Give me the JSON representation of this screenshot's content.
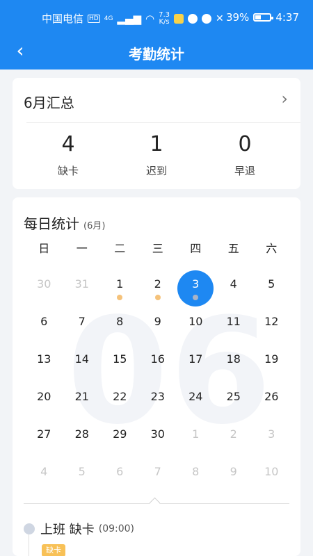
{
  "status_bar": {
    "carrier": "中国电信",
    "hd": "HD",
    "network": "4G",
    "speed_top": "7.3",
    "speed_bottom": "K/s",
    "battery": "39%",
    "time": "4:37"
  },
  "header": {
    "title": "考勤统计"
  },
  "summary": {
    "title": "6月汇总",
    "stats": [
      {
        "value": "4",
        "label": "缺卡"
      },
      {
        "value": "1",
        "label": "迟到"
      },
      {
        "value": "0",
        "label": "早退"
      }
    ]
  },
  "daily": {
    "title": "每日统计",
    "month_tag": "(6月)",
    "watermark": "06",
    "weekdays": [
      "日",
      "一",
      "二",
      "三",
      "四",
      "五",
      "六"
    ],
    "weeks": [
      [
        "30",
        "31",
        "1",
        "2",
        "3",
        "4",
        "5"
      ],
      [
        "6",
        "7",
        "8",
        "9",
        "10",
        "11",
        "12"
      ],
      [
        "13",
        "14",
        "15",
        "16",
        "17",
        "18",
        "19"
      ],
      [
        "20",
        "21",
        "22",
        "23",
        "24",
        "25",
        "26"
      ],
      [
        "27",
        "28",
        "29",
        "30",
        "1",
        "2",
        "3"
      ],
      [
        "4",
        "5",
        "6",
        "7",
        "8",
        "9",
        "10"
      ]
    ]
  },
  "record": {
    "title": "上班 缺卡",
    "time": "(09:00)",
    "badge": "缺卡"
  }
}
